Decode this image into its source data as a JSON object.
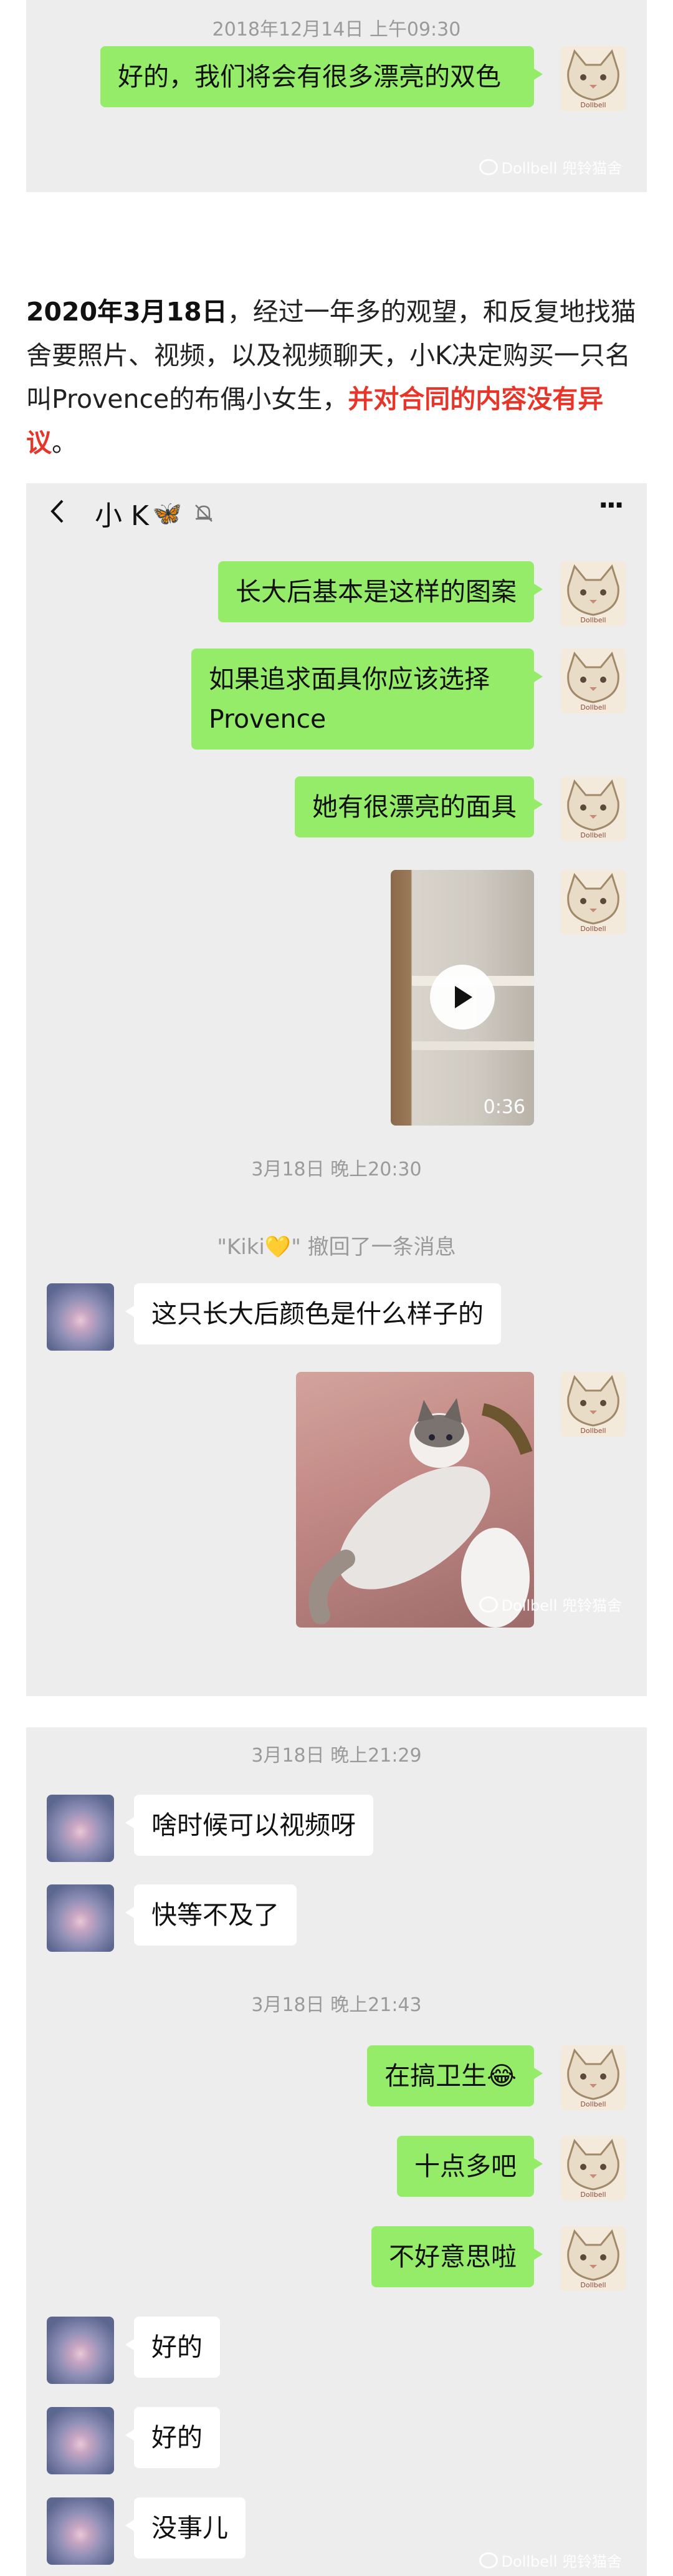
{
  "panel1": {
    "timestamp": "2018年12月14日 上午09:30",
    "message": "好的，我们将会有很多漂亮的双色",
    "watermark": "Dollbell 兜铃猫舍"
  },
  "paragraph": {
    "date": "2020年3月18日",
    "text1": "，经过一年多的观望，和反复地找猫舍要照片、视频，以及视频聊天，小K决定购买一只名叫Provence的布偶小女生，",
    "highlight": "并对合同的内容没有异议",
    "end": "。"
  },
  "chat_header": {
    "back_icon": "chevron-left-icon",
    "name": "小 K",
    "emoji": "🦋",
    "mute_icon": "bell-off-icon",
    "more": "···"
  },
  "panel2": {
    "msg1": "长大后基本是这样的图案",
    "msg2": "如果追求面具你应该选择Provence",
    "msg3": "她有很漂亮的面具",
    "video_duration": "0:36",
    "timestamp": "3月18日 晚上20:30",
    "recall": "\"Kiki💛\" 撤回了一条消息",
    "msg4": "这只长大后颜色是什么样子的",
    "watermark": "Dollbell 兜铃猫舍"
  },
  "panel3": {
    "timestamp1": "3月18日 晚上21:29",
    "msg1": "啥时候可以视频呀",
    "msg2": "快等不及了",
    "timestamp2": "3月18日 晚上21:43",
    "msg3": "在搞卫生😂",
    "msg4": "十点多吧",
    "msg5": "不好意思啦",
    "msg6": "好的",
    "msg7": "好的",
    "msg8": "没事儿",
    "watermark": "Dollbell 兜铃猫舍"
  },
  "avatar_text": "Dollbell"
}
